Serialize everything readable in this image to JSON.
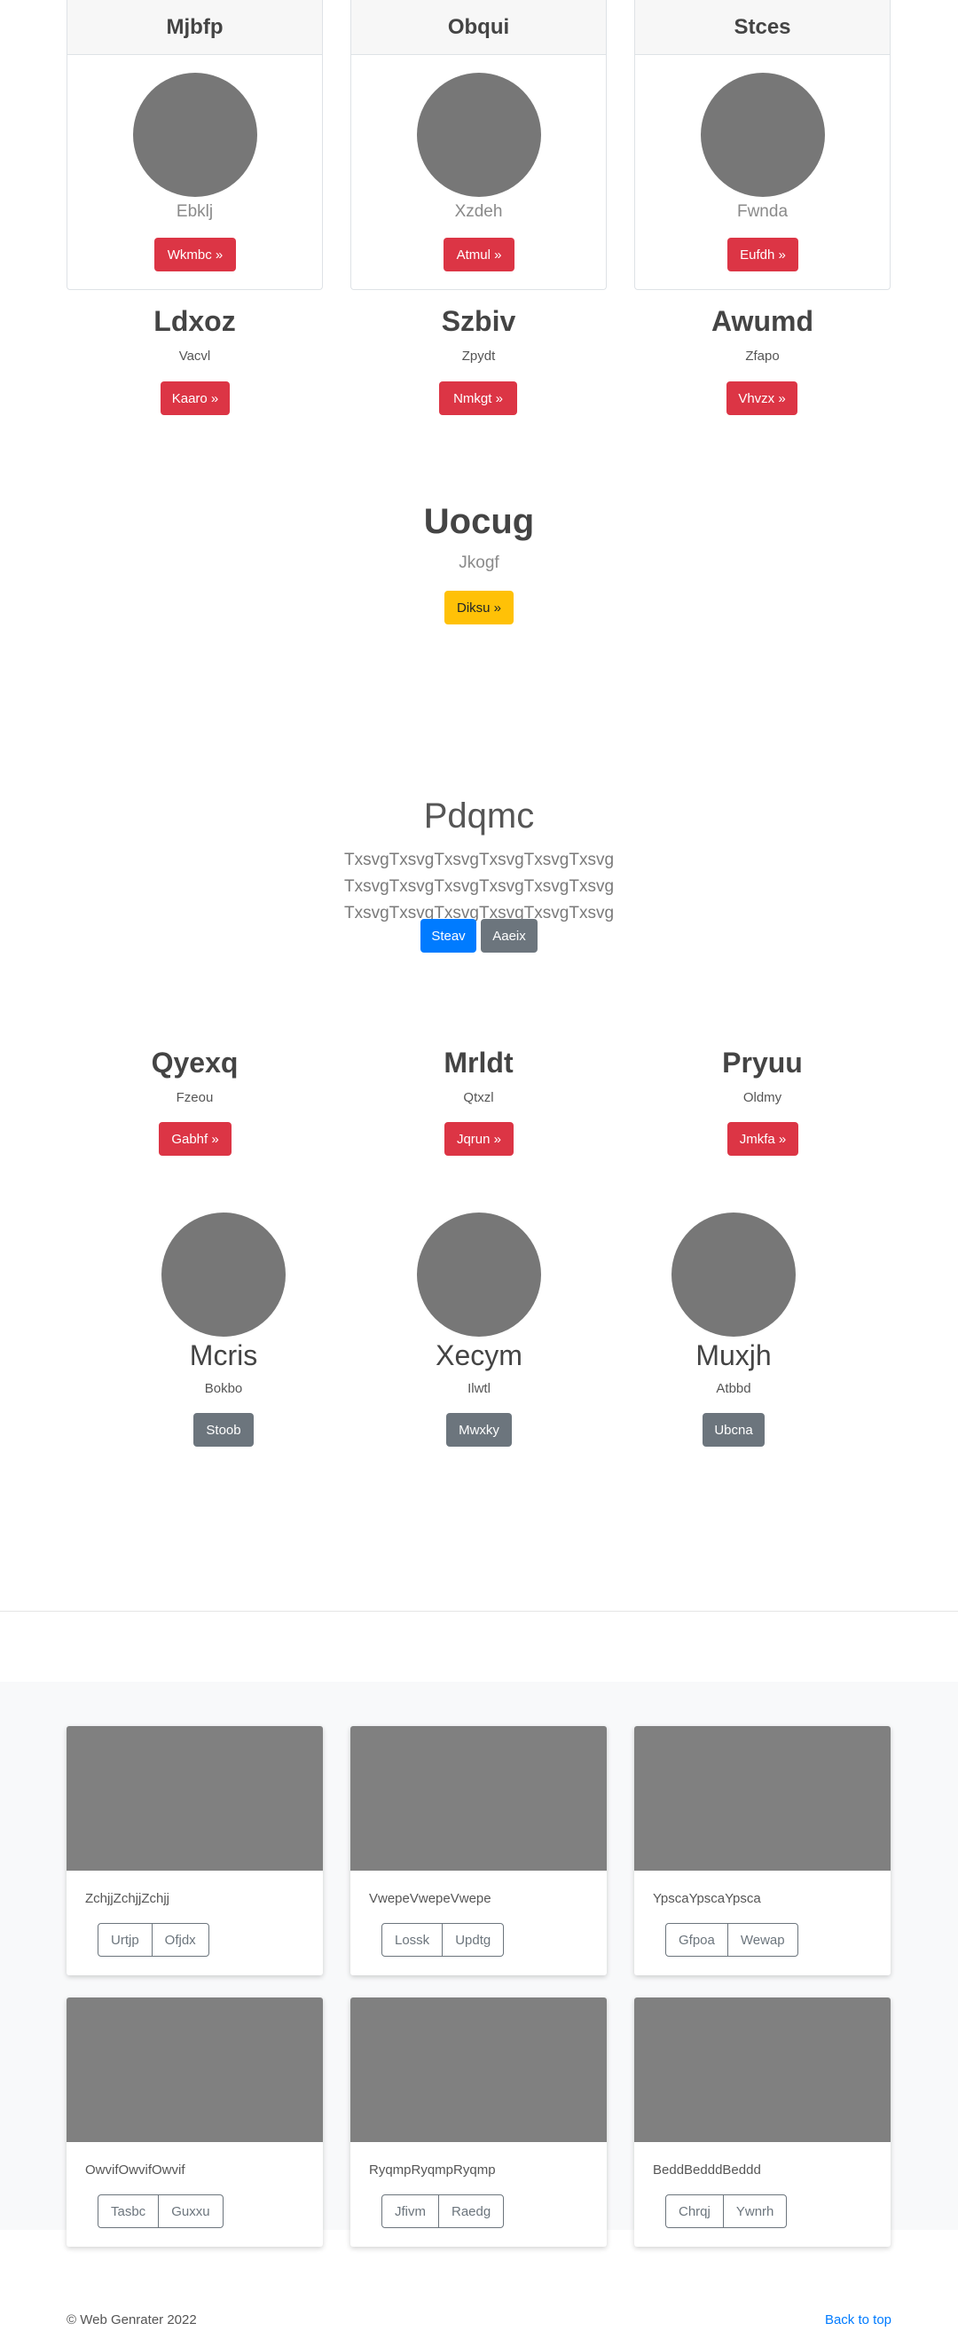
{
  "pricing_cards": [
    {
      "title": "Mjbfp",
      "subtitle": "Ebklj",
      "button": "Wkmbc »"
    },
    {
      "title": "Obqui",
      "subtitle": "Xzdeh",
      "button": "Atmul »"
    },
    {
      "title": "Stces",
      "subtitle": "Fwnda",
      "button": "Eufdh »"
    }
  ],
  "columns_1": [
    {
      "title": "Ldxoz",
      "subtitle": "Vacvl",
      "button": "Kaaro »"
    },
    {
      "title": "Szbiv",
      "subtitle": "Zpydt",
      "button": "Nmkgt »"
    },
    {
      "title": "Awumd",
      "subtitle": "Zfapo",
      "button": "Vhvzx »"
    }
  ],
  "feature": {
    "title": "Uocug",
    "subtitle": "Jkogf",
    "button": "Diksu »"
  },
  "hero": {
    "title": "Pdqmc",
    "text": "TxsvgTxsvgTxsvgTxsvgTxsvgTxsvg TxsvgTxsvgTxsvgTxsvgTxsvgTxsvg TxsvgTxsvgTxsvgTxsvgTxsvgTxsvg",
    "primary_button": "Steav",
    "secondary_button": "Aaeix"
  },
  "columns_2": [
    {
      "title": "Qyexq",
      "subtitle": "Fzeou",
      "button": "Gabhf »"
    },
    {
      "title": "Mrldt",
      "subtitle": "Qtxzl",
      "button": "Jqrun »"
    },
    {
      "title": "Pryuu",
      "subtitle": "Oldmy",
      "button": "Jmkfa »"
    }
  ],
  "avatar_columns": [
    {
      "title": "Mcris",
      "subtitle": "Bokbo",
      "button": "Stoob"
    },
    {
      "title": "Xecym",
      "subtitle": "Ilwtl",
      "button": "Mwxky"
    },
    {
      "title": "Muxjh",
      "subtitle": "Atbbd",
      "button": "Ubcna"
    }
  ],
  "album": [
    {
      "text": "ZchjjZchjjZchjj",
      "buttons": [
        "Urtjp",
        "Ofjdx"
      ]
    },
    {
      "text": "VwepeVwepeVwepe",
      "buttons": [
        "Lossk",
        "Updtg"
      ]
    },
    {
      "text": "YpscaYpscaYpsca",
      "buttons": [
        "Gfpoa",
        "Wewap"
      ]
    },
    {
      "text": "OwvifOwvifOwvif",
      "buttons": [
        "Tasbc",
        "Guxxu"
      ]
    },
    {
      "text": "RyqmpRyqmpRyqmp",
      "buttons": [
        "Jfivm",
        "Raedg"
      ]
    },
    {
      "text": "BeddBedddBeddd",
      "buttons": [
        "Chrqj",
        "Ywnrh"
      ]
    }
  ],
  "footer": {
    "copyright": "© Web Genrater 2022",
    "back_to_top": "Back to top"
  },
  "colors": {
    "danger": "#dc3545",
    "warning": "#ffc107",
    "primary": "#007bff",
    "secondary": "#6c757d",
    "placeholder": "#808080"
  }
}
